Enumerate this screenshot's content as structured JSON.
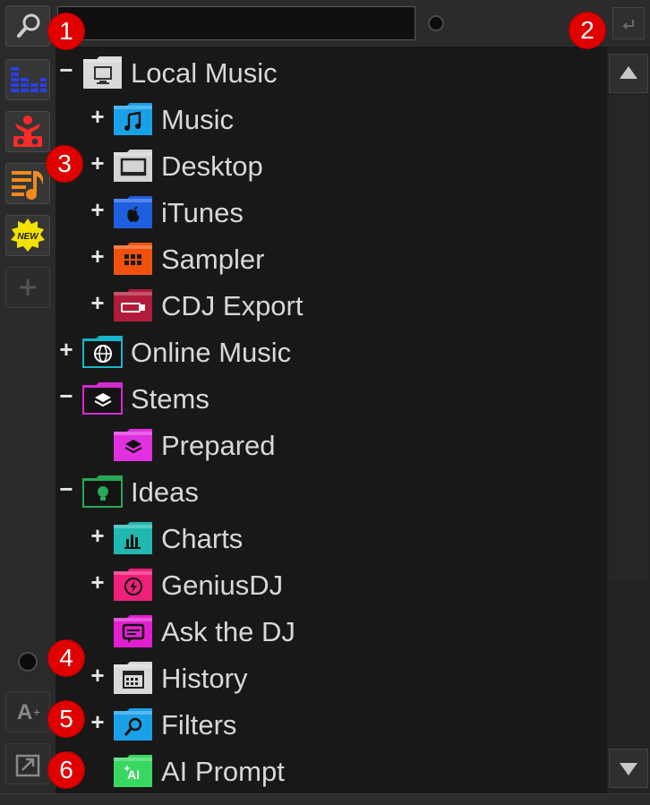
{
  "search": {
    "value": "",
    "placeholder": ""
  },
  "sidebar": {
    "buttons": [
      {
        "name": "search-toggle-button",
        "icon": "magnifier-icon"
      },
      {
        "name": "sidelist-button",
        "icon": "equalizer-icon"
      },
      {
        "name": "automix-button",
        "icon": "dj-robot-icon"
      },
      {
        "name": "karaoke-list-button",
        "icon": "playlist-note-icon"
      },
      {
        "name": "new-tracks-button",
        "icon": "new-badge-icon"
      },
      {
        "name": "add-sideview-button",
        "icon": "plus-icon"
      },
      {
        "name": "text-size-button",
        "icon": "font-size-icon",
        "label": "A"
      },
      {
        "name": "popout-browser-button",
        "icon": "popout-icon"
      }
    ]
  },
  "tree": {
    "items": [
      {
        "label": "Local Music",
        "level": 0,
        "expander": "−",
        "icon": "computer-folder-icon",
        "color": "#d9d9d9"
      },
      {
        "label": "Music",
        "level": 1,
        "expander": "+",
        "icon": "music-note-folder-icon",
        "color": "#1aa0e8"
      },
      {
        "label": "Desktop",
        "level": 1,
        "expander": "+",
        "icon": "desktop-folder-icon",
        "color": "#d4d4d4"
      },
      {
        "label": "iTunes",
        "level": 1,
        "expander": "+",
        "icon": "apple-folder-icon",
        "color": "#1e5fe0"
      },
      {
        "label": "Sampler",
        "level": 1,
        "expander": "+",
        "icon": "sampler-folder-icon",
        "color": "#f0520e"
      },
      {
        "label": "CDJ Export",
        "level": 1,
        "expander": "+",
        "icon": "usb-folder-icon",
        "color": "#b01c3a"
      },
      {
        "label": "Online Music",
        "level": 0,
        "expander": "+",
        "icon": "globe-folder-icon",
        "color": "#18b5c8"
      },
      {
        "label": "Stems",
        "level": 0,
        "expander": "−",
        "icon": "stems-folder-icon",
        "color": "#d42ad4"
      },
      {
        "label": "Prepared",
        "level": 1,
        "expander": "",
        "icon": "stems-layers-folder-icon",
        "color": "#e030e0"
      },
      {
        "label": "Ideas",
        "level": 0,
        "expander": "−",
        "icon": "lightbulb-folder-icon",
        "color": "#28a855"
      },
      {
        "label": "Charts",
        "level": 1,
        "expander": "+",
        "icon": "chart-folder-icon",
        "color": "#20b8b0"
      },
      {
        "label": "GeniusDJ",
        "level": 1,
        "expander": "+",
        "icon": "genius-folder-icon",
        "color": "#f0207a"
      },
      {
        "label": "Ask the DJ",
        "level": 1,
        "expander": "",
        "icon": "chat-folder-icon",
        "color": "#e020d0"
      },
      {
        "label": "History",
        "level": 1,
        "expander": "+",
        "icon": "calendar-folder-icon",
        "color": "#d8d8d8"
      },
      {
        "label": "Filters",
        "level": 1,
        "expander": "+",
        "icon": "filter-folder-icon",
        "color": "#1aa0e8"
      },
      {
        "label": "AI Prompt",
        "level": 1,
        "expander": "",
        "icon": "ai-folder-icon",
        "color": "#38d860"
      }
    ]
  },
  "badges": [
    "1",
    "2",
    "3",
    "4",
    "5",
    "6"
  ],
  "colors": {
    "badge": "#e00000",
    "background": "#181818",
    "text": "#d8d8d8"
  }
}
